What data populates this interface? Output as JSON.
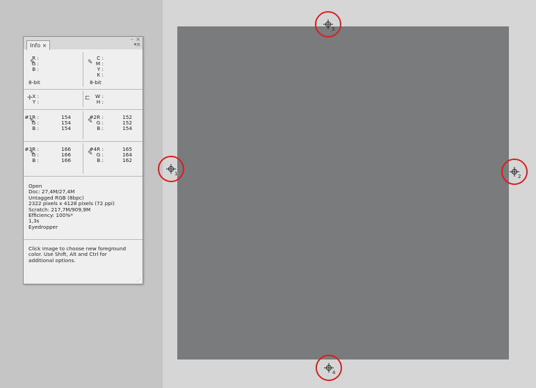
{
  "panel": {
    "tab_label": "Info ×",
    "minimize_label": "–",
    "close_label": "×",
    "menu_label": "▾≡",
    "rgb_labels": [
      "R :",
      "G :",
      "B :"
    ],
    "cmyk_labels": [
      "C :",
      "M :",
      "Y :",
      "K :"
    ],
    "bit_depth_left": "8-bit",
    "bit_depth_right": "8-bit",
    "xy_labels": [
      "X :",
      "Y :"
    ],
    "wh_labels": [
      "W :",
      "H :"
    ],
    "samplers": [
      {
        "labels": [
          "#1R :",
          "G :",
          "B :"
        ],
        "values": [
          "154",
          "154",
          "154"
        ]
      },
      {
        "labels": [
          "#2R :",
          "G :",
          "B :"
        ],
        "values": [
          "152",
          "152",
          "154"
        ]
      },
      {
        "labels": [
          "#3R :",
          "G :",
          "B :"
        ],
        "values": [
          "166",
          "166",
          "166"
        ]
      },
      {
        "labels": [
          "#4R :",
          "G :",
          "B :"
        ],
        "values": [
          "165",
          "164",
          "162"
        ]
      }
    ],
    "status_lines": [
      "Open",
      "Doc: 27,4M/27,4M",
      "Untagged RGB (8bpc)",
      "2322 pixels x 4128 pixels (72 ppi)",
      "Scratch: 217,7M/909,9M",
      "Efficiency: 100%*",
      "1,3s",
      "Eyedropper"
    ],
    "hint_lines": [
      "Click image to choose new foreground",
      "color.  Use Shift, Alt and Ctrl for",
      "additional options."
    ],
    "resize_grip": "⋰"
  },
  "markers": [
    {
      "id": "1",
      "label": "1"
    },
    {
      "id": "2",
      "label": "2"
    },
    {
      "id": "3",
      "label": "3"
    },
    {
      "id": "4",
      "label": "4"
    }
  ],
  "colors": {
    "marker": "#d61f1f",
    "gray_sample": "#7a7b7c",
    "canvas_bg": "#d6d6d6"
  }
}
